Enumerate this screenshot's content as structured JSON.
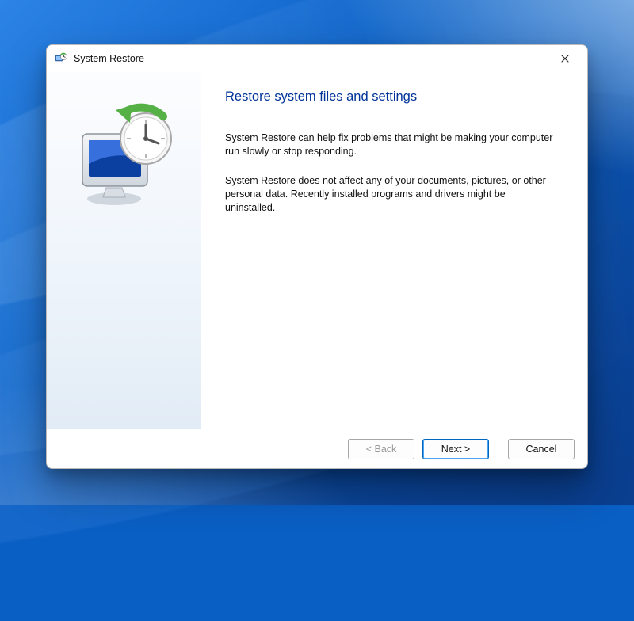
{
  "window": {
    "title": "System Restore",
    "icon": "system-restore-icon"
  },
  "content": {
    "heading": "Restore system files and settings",
    "paragraph1": "System Restore can help fix problems that might be making your computer run slowly or stop responding.",
    "paragraph2": "System Restore does not affect any of your documents, pictures, or other personal data. Recently installed programs and drivers might be uninstalled."
  },
  "buttons": {
    "back": "< Back",
    "next": "Next >",
    "cancel": "Cancel"
  },
  "colors": {
    "heading": "#003399",
    "primary_border": "#0067c0"
  }
}
